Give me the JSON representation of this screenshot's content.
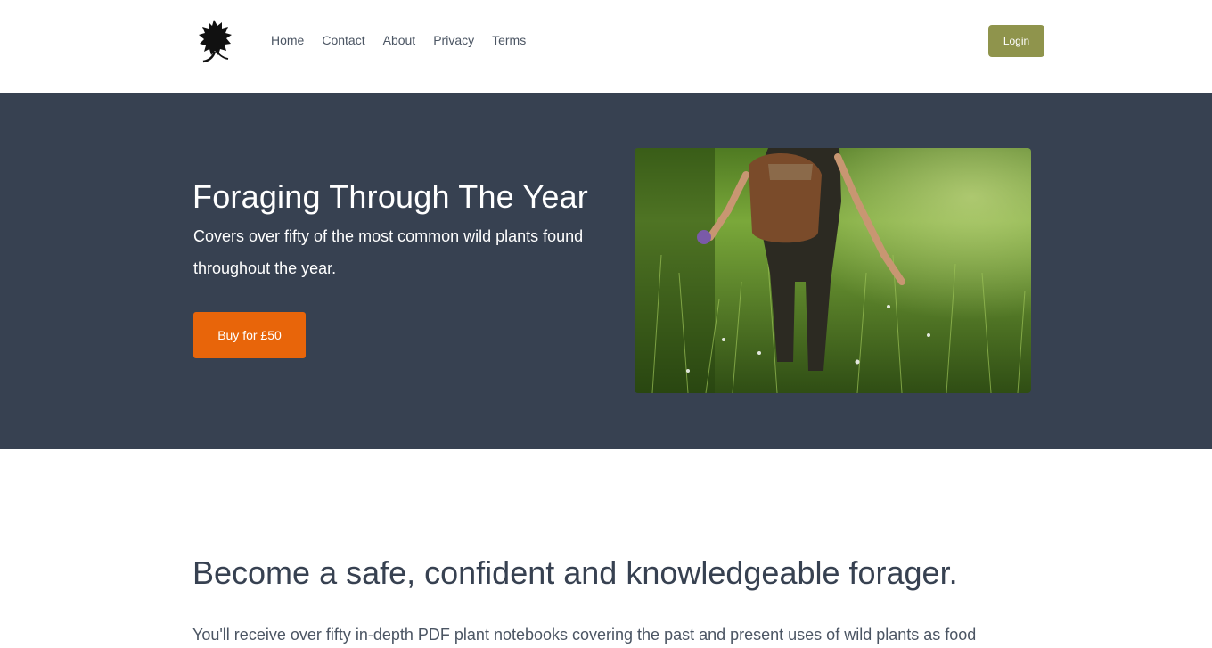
{
  "header": {
    "logo_icon": "leaf-silhouette-icon",
    "nav": [
      {
        "label": "Home"
      },
      {
        "label": "Contact"
      },
      {
        "label": "About"
      },
      {
        "label": "Privacy"
      },
      {
        "label": "Terms"
      }
    ],
    "login_label": "Login"
  },
  "hero": {
    "title": "Foraging Through The Year",
    "subtitle": "Covers over fifty of the most common wild plants found throughout the year.",
    "buy_label": "Buy for £50",
    "image": "person-walking-in-grass-meadow"
  },
  "main": {
    "heading": "Become a safe, confident and knowledgeable forager.",
    "text": "You'll receive over fifty in-depth PDF plant notebooks covering the past and present uses of wild plants as food"
  },
  "colors": {
    "hero_bg": "#374151",
    "login_bg": "#8f944c",
    "buy_bg": "#e8650a"
  }
}
